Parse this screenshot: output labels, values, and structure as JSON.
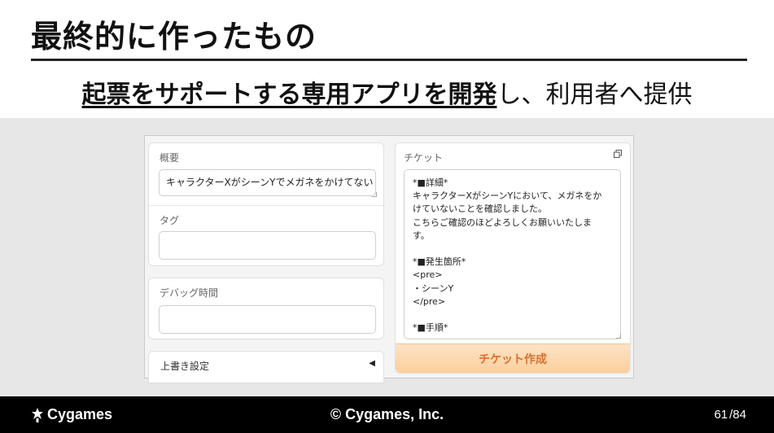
{
  "slide": {
    "title": "最終的に作ったもの",
    "subtitle_emphasis": "起票をサポートする専用アプリを開発",
    "subtitle_rest": "し、利用者へ提供"
  },
  "form": {
    "summary_label": "概要",
    "summary_value": "キャラクターXがシーンYでメガネをかけてない",
    "tag_label": "タグ",
    "tag_value": "",
    "debug_time_label": "デバッグ時間",
    "debug_time_value": "",
    "override_label": "上書き設定",
    "override_icon": "triangle-left-icon"
  },
  "ticket": {
    "label": "チケット",
    "copy_icon": "copy-icon",
    "lines": [
      "*■詳細*",
      "キャラクターXがシーンYにおいて、メガネをか",
      "けていないことを確認しました。",
      "こちらご確認のほどよろしくお願いいたしま",
      "す。",
      "",
      "*■発生箇所*",
      "<pre>",
      "・シーンY",
      "</pre>",
      "",
      "*■手順*"
    ],
    "create_button": "チケット作成"
  },
  "footer": {
    "logo_text": "Cygames",
    "copyright": "© Cygames, Inc.",
    "page_current": "61",
    "page_total": "/84"
  },
  "colors": {
    "button_text": "#d9712f",
    "button_bg": "#fbcf9d",
    "band": "#e7e7e7",
    "footer": "#000000"
  }
}
